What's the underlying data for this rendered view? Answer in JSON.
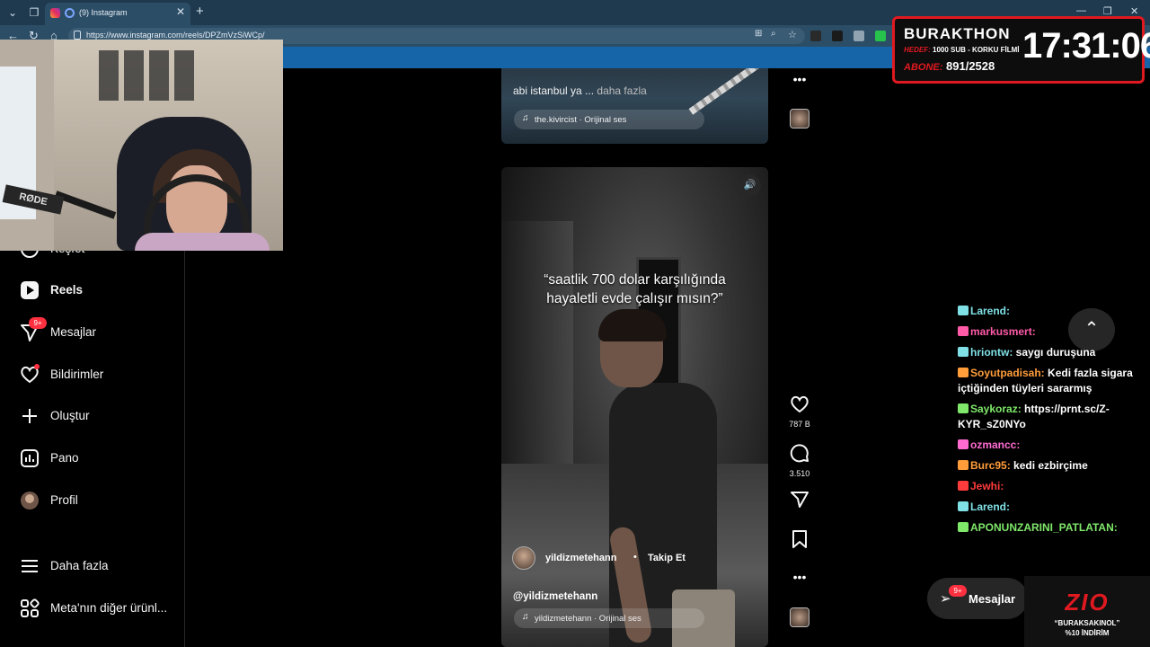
{
  "browser": {
    "tab_title": "(9) Instagram",
    "url": "https://www.instagram.com/reels/DPZmVzSiWCp/"
  },
  "sidebar": {
    "items": [
      {
        "label": "Keşfet"
      },
      {
        "label": "Reels"
      },
      {
        "label": "Mesajlar",
        "badge": "9+"
      },
      {
        "label": "Bildirimler"
      },
      {
        "label": "Oluştur"
      },
      {
        "label": "Pano"
      },
      {
        "label": "Profil"
      },
      {
        "label": "Daha fazla"
      },
      {
        "label": "Meta'nın diğer ürünl..."
      }
    ]
  },
  "prev_reel": {
    "caption": "abi istanbul ya ...",
    "more": "daha fazla",
    "audio": "the.kivircist · Orijinal ses"
  },
  "reel": {
    "quote": "“saatlik 700 dolar karşılığında hayaletli evde çalışır mısın?”",
    "author": "yildizmetehann",
    "follow": "Takip Et",
    "handle": "@yildizmetehann",
    "audio": "yildizmetehann · Orijinal ses",
    "likes": "787 B",
    "comments": "3.510"
  },
  "overlay": {
    "timer_title": "BURAKTHON",
    "goal_label": "HEDEF:",
    "goal_text": "1000 SUB - KORKU FİLMİ",
    "subs_label": "ABONE:",
    "subs_value": "891/2528",
    "clock": "17:31:06",
    "webcam_mic_brand": "RØDE"
  },
  "chat": [
    {
      "user": "Larend:",
      "text": "",
      "color": "#7fe0e6"
    },
    {
      "user": "markusmert:",
      "text": "",
      "color": "#ff5aa8"
    },
    {
      "user": "hriontw:",
      "text": "saygı duruşuna",
      "color": "#7fe0e6"
    },
    {
      "user": "Soyutpadisah:",
      "text": "Kedi fazla sigara içtiğinden tüyleri sararmış",
      "color": "#ff9d3b"
    },
    {
      "user": "Saykoraz:",
      "text": "https://prnt.sc/Z-KYR_sZ0NYo",
      "color": "#7fe86a"
    },
    {
      "user": "ozmancc:",
      "text": "",
      "color": "#ff6bd1"
    },
    {
      "user": "Burc95:",
      "text": "kedi ezbirçime",
      "color": "#ff9d3b"
    },
    {
      "user": "Jewhi:",
      "text": "",
      "color": "#ff3b3b"
    },
    {
      "user": "Larend:",
      "text": "",
      "color": "#7fe0e6"
    },
    {
      "user": "APONUNZARINI_PATLATAN:",
      "text": "",
      "color": "#7fe86a"
    }
  ],
  "messages_pill": {
    "label": "Mesajlar",
    "badge": "9+"
  },
  "sponsor": {
    "logo": "ZIO",
    "code": "“BURAKSAKINOL”",
    "discount": "%10 İNDİRİM"
  },
  "colors": {
    "accent_red": "#e01921",
    "ig_badge": "#ff3040",
    "browser_bar": "#2c4d66"
  }
}
